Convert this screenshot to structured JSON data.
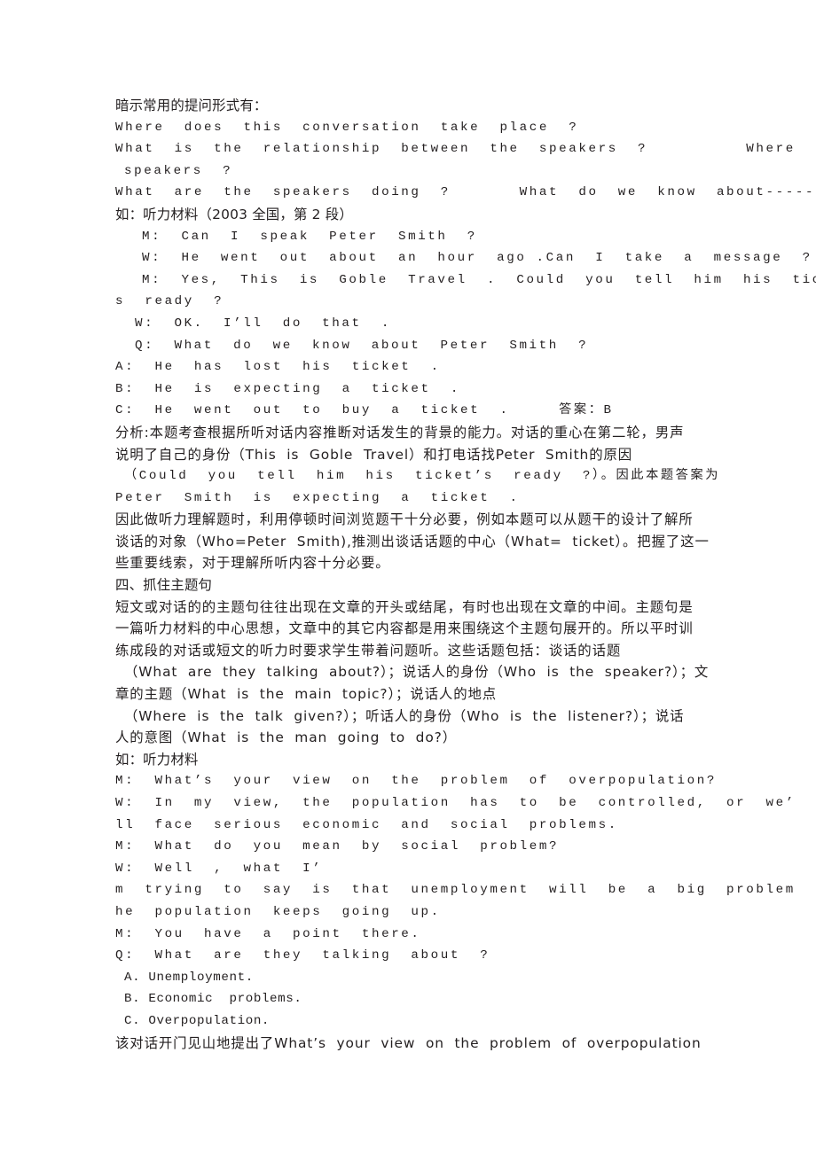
{
  "document": {
    "page_background": "#ffffff",
    "text_color": "#231f20",
    "lines": [
      {
        "id": "l01",
        "indent": 0,
        "script": "cn",
        "text": "暗示常用的提问形式有："
      },
      {
        "id": "l02",
        "indent": 0,
        "script": "en-t",
        "text": "Where  does  this  conversation  take  place  ?"
      },
      {
        "id": "l03",
        "indent": 0,
        "script": "en-t",
        "text": "What  is  the  relationship  between  the  speakers  ?          Where  are  the"
      },
      {
        "id": "l04",
        "indent": 1,
        "script": "en-t",
        "text": "speakers  ?"
      },
      {
        "id": "l05",
        "indent": 0,
        "script": "en-t",
        "text": "What  are  the  speakers  doing  ?       What  do  we  know  about------  ?"
      },
      {
        "id": "l06",
        "indent": 0,
        "script": "cn",
        "text": "如：听力材料（2003 全国，第 2 段）"
      },
      {
        "id": "l07",
        "indent": 2,
        "script": "en-t",
        "text": "M:  Can  I  speak  Peter  Smith  ?"
      },
      {
        "id": "l08",
        "indent": 2,
        "script": "en-t",
        "text": "W:  He  went  out  about  an  hour  ago .Can  I  take  a  message  ?"
      },
      {
        "id": "l09",
        "indent": 2,
        "script": "en-t",
        "text": "M:  Yes,  This  is  Goble  Travel  .  Could  you  tell  him  his  ticket’"
      },
      {
        "id": "l10",
        "indent": 0,
        "script": "en-t",
        "text": "s  ready  ?"
      },
      {
        "id": "l11",
        "indent": 1,
        "script": "en-t",
        "text": "W:  OK.  I’ll  do  that  ."
      },
      {
        "id": "l12",
        "indent": 1,
        "script": "en-t",
        "text": "Q:  What  do  we  know  about  Peter  Smith  ?"
      },
      {
        "id": "l13",
        "indent": 0,
        "script": "en-t",
        "text": "A:  He  has  lost  his  ticket  ."
      },
      {
        "id": "l14",
        "indent": 0,
        "script": "en-t",
        "text": "B:  He  is  expecting  a  ticket  ."
      },
      {
        "id": "l15",
        "indent": 0,
        "script": "mixed",
        "text": "C:  He  went  out  to  buy  a  ticket  .     答案：B"
      },
      {
        "id": "l16",
        "indent": 0,
        "script": "cn-j",
        "text": "分析:本题考查根据所听对话内容推断对话发生的背景的能力。对话的重心在第二轮，男声"
      },
      {
        "id": "l17",
        "indent": 0,
        "script": "mixed",
        "text": "说明了自己的身份（This  is  Goble  Travel）和打电话找Peter  Smith的原因"
      },
      {
        "id": "l18",
        "indent": 1,
        "script": "en-t",
        "text": "（Could  you  tell  him  his  ticket’s  ready  ?）。因此本题答案为"
      },
      {
        "id": "l19",
        "indent": 0,
        "script": "en-t",
        "text": "Peter  Smith  is  expecting  a  ticket  ."
      },
      {
        "id": "l20",
        "indent": 0,
        "script": "cn-j",
        "text": "因此做听力理解题时，利用停顿时间浏览题干十分必要，例如本题可以从题干的设计了解所"
      },
      {
        "id": "l21",
        "indent": 0,
        "script": "mixed",
        "text": "谈话的对象（Who=Peter  Smith),推测出谈话话题的中心（What=  ticket）。把握了这一"
      },
      {
        "id": "l22",
        "indent": 0,
        "script": "cn-j",
        "text": "些重要线索，对于理解所听内容十分必要。"
      },
      {
        "id": "l23",
        "indent": 0,
        "script": "cn",
        "text": "四、抓住主题句"
      },
      {
        "id": "l24",
        "indent": 0,
        "script": "cn-j",
        "text": "短文或对话的的主题句往往出现在文章的开头或结尾，有时也出现在文章的中间。主题句是"
      },
      {
        "id": "l25",
        "indent": 0,
        "script": "cn-j",
        "text": "一篇听力材料的中心思想，文章中的其它内容都是用来围绕这个主题句展开的。所以平时训"
      },
      {
        "id": "l26",
        "indent": 0,
        "script": "cn-j",
        "text": "练成段的对话或短文的听力时要求学生带着问题听。这些话题包括：谈话的话题"
      },
      {
        "id": "l27",
        "indent": 1,
        "script": "mixed",
        "text": "（What  are  they  talking  about?）；说话人的身份（Who  is  the  speaker?）；文"
      },
      {
        "id": "l28",
        "indent": 0,
        "script": "mixed",
        "text": "章的主题（What  is  the  main  topic?）；说话人的地点"
      },
      {
        "id": "l29",
        "indent": 1,
        "script": "mixed",
        "text": "（Where  is  the  talk  given?）；听话人的身份（Who  is  the  listener?）；说话"
      },
      {
        "id": "l30",
        "indent": 0,
        "script": "mixed",
        "text": "人的意图（What  is  the  man  going  to  do?）"
      },
      {
        "id": "l31",
        "indent": 0,
        "script": "cn",
        "text": "如：听力材料"
      },
      {
        "id": "l32",
        "indent": 0,
        "script": "en-t",
        "text": "M:  What’s  your  view  on  the  problem  of  overpopulation?"
      },
      {
        "id": "l33",
        "indent": 0,
        "script": "en-t",
        "text": "W:  In  my  view,  the  population  has  to  be  controlled,  or  we’"
      },
      {
        "id": "l34",
        "indent": 0,
        "script": "en-t",
        "text": "ll  face  serious  economic  and  social  problems."
      },
      {
        "id": "l35",
        "indent": 0,
        "script": "en-t",
        "text": "M:  What  do  you  mean  by  social  problem?"
      },
      {
        "id": "l36",
        "indent": 0,
        "script": "en-t",
        "text": "W:  Well  ,  what  I’"
      },
      {
        "id": "l37",
        "indent": 0,
        "script": "en-t",
        "text": "m  trying  to  say  is  that  unemployment  will  be  a  big  problem  ,  if  t"
      },
      {
        "id": "l38",
        "indent": 0,
        "script": "en-t",
        "text": "he  population  keeps  going  up."
      },
      {
        "id": "l39",
        "indent": 0,
        "script": "en-t",
        "text": "M:  You  have  a  point  there."
      },
      {
        "id": "l40",
        "indent": 0,
        "script": "en-t",
        "text": "Q:  What  are  they  talking  about  ?"
      },
      {
        "id": "l41",
        "indent": 1,
        "script": "en",
        "text": "A. Unemployment."
      },
      {
        "id": "l42",
        "indent": 1,
        "script": "en",
        "text": "B. Economic  problems."
      },
      {
        "id": "l43",
        "indent": 1,
        "script": "en",
        "text": "C. Overpopulation."
      },
      {
        "id": "l44",
        "indent": 0,
        "script": "mixed",
        "text": "该对话开门见山地提出了What’s  your  view  on  the  problem  of  overpopulation"
      }
    ]
  }
}
